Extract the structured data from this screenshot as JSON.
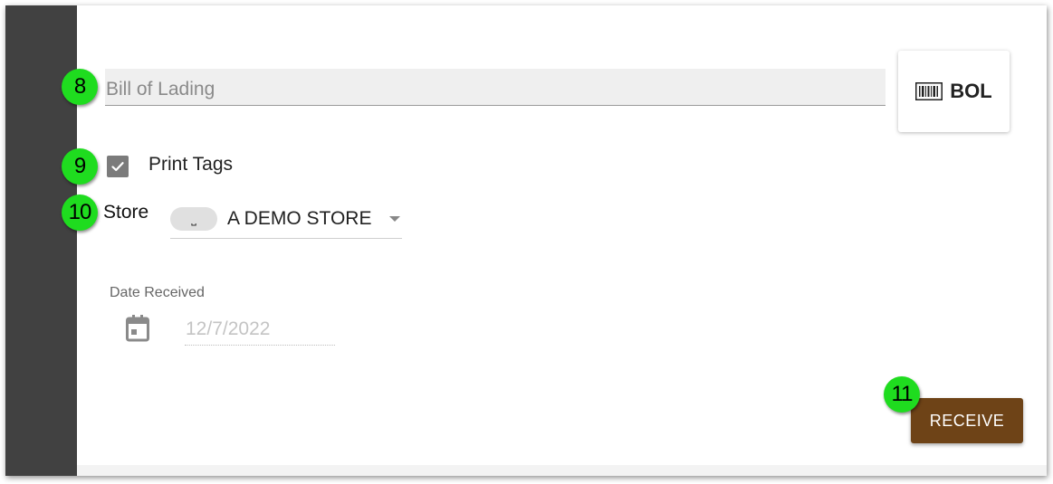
{
  "callouts": [
    "8",
    "9",
    "10",
    "11"
  ],
  "bol": {
    "placeholder": "Bill of Lading",
    "value": "",
    "button_label": "BOL",
    "button_icon": "barcode-icon"
  },
  "print_tags": {
    "label": "Print Tags",
    "checked": true
  },
  "store": {
    "label": "Store",
    "chip": "⎵",
    "selected": "A DEMO STORE"
  },
  "date_received": {
    "label": "Date Received",
    "value": "12/7/2022",
    "icon": "calendar-icon"
  },
  "receive_button": {
    "label": "RECEIVE"
  },
  "colors": {
    "sidebar": "#414141",
    "callout": "#1fdc1f",
    "receive_button": "#6e4317",
    "checkbox": "#7b7b7b",
    "input_background": "#efefef"
  }
}
